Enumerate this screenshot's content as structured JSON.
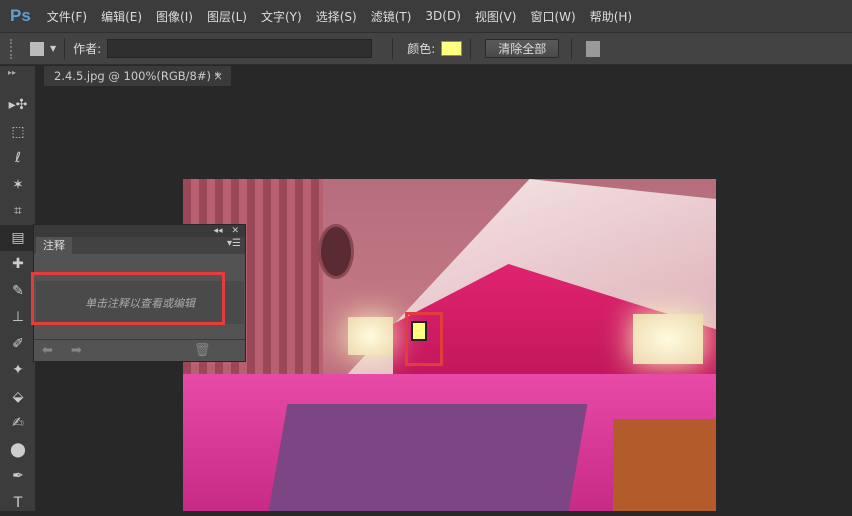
{
  "app": {
    "logo": "Ps"
  },
  "menu": [
    "文件(F)",
    "编辑(E)",
    "图像(I)",
    "图层(L)",
    "文字(Y)",
    "选择(S)",
    "滤镜(T)",
    "3D(D)",
    "视图(V)",
    "窗口(W)",
    "帮助(H)"
  ],
  "options": {
    "author_label": "作者:",
    "author_value": "",
    "color_label": "颜色:",
    "color": "#ffff80",
    "clear_all": "清除全部"
  },
  "document": {
    "tab_title": "2.4.5.jpg @ 100%(RGB/8#) *",
    "close": "×"
  },
  "notes_panel": {
    "tab": "注释",
    "hint": "单击注释以查看或编辑",
    "collapse": "◂◂",
    "close": "✕"
  },
  "tools": [
    "▸✣",
    "⬚",
    "ℓ",
    "✶",
    "⌗",
    "▤",
    "✚",
    "✎",
    "⊥",
    "✐",
    "✦",
    "⬙",
    "✍",
    "⬤",
    "✒",
    "T"
  ]
}
